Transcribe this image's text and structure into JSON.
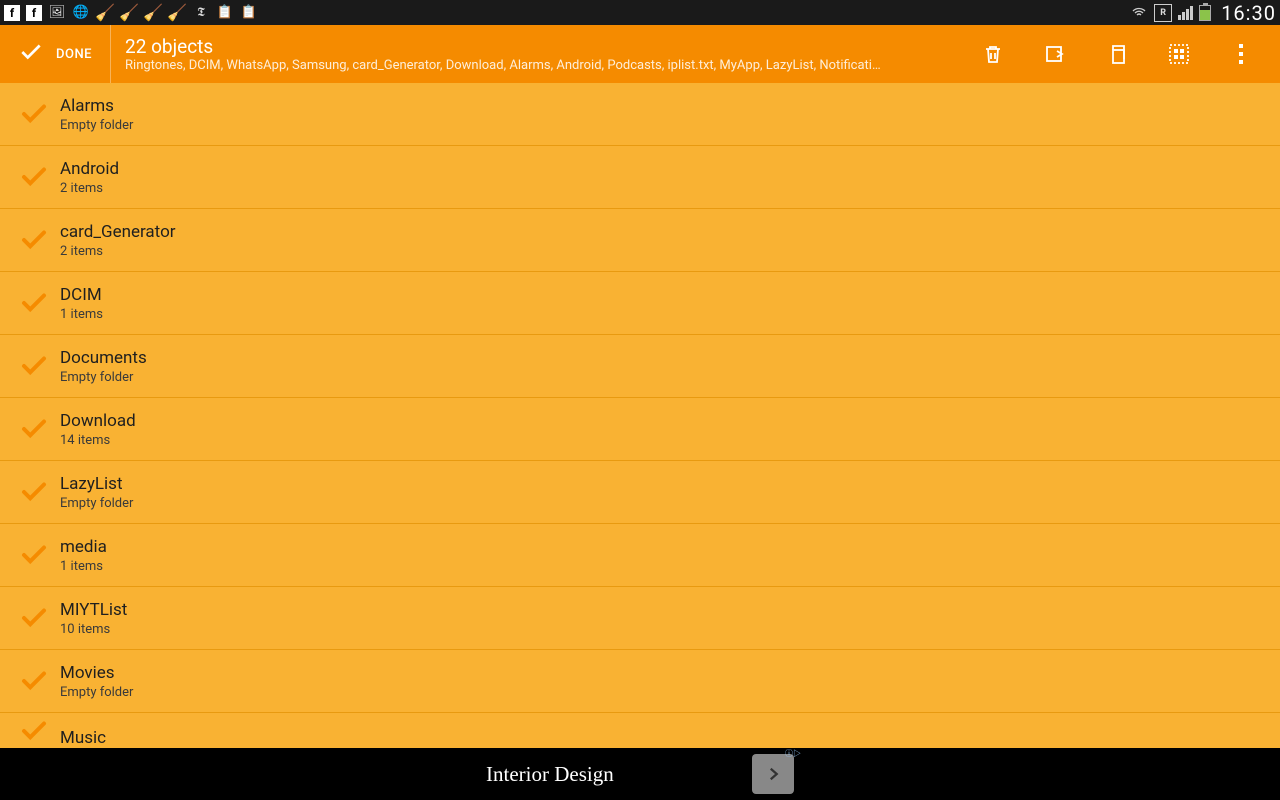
{
  "statusbar": {
    "time": "16:30"
  },
  "actionbar": {
    "done_label": "DONE",
    "title": "22 objects",
    "subtitle": "Ringtones, DCIM, WhatsApp, Samsung, card_Generator, Download, Alarms, Android, Podcasts, iplist.txt, MyApp, LazyList, Notificati…"
  },
  "items": [
    {
      "name": "Alarms",
      "sub": "Empty folder"
    },
    {
      "name": "Android",
      "sub": "2 items"
    },
    {
      "name": "card_Generator",
      "sub": "2 items"
    },
    {
      "name": "DCIM",
      "sub": "1 items"
    },
    {
      "name": "Documents",
      "sub": "Empty folder"
    },
    {
      "name": "Download",
      "sub": "14 items"
    },
    {
      "name": "LazyList",
      "sub": "Empty folder"
    },
    {
      "name": "media",
      "sub": "1 items"
    },
    {
      "name": "MIYTList",
      "sub": "10 items"
    },
    {
      "name": "Movies",
      "sub": "Empty folder"
    },
    {
      "name": "Music",
      "sub": ""
    }
  ],
  "ad": {
    "text": "Interior Design"
  }
}
